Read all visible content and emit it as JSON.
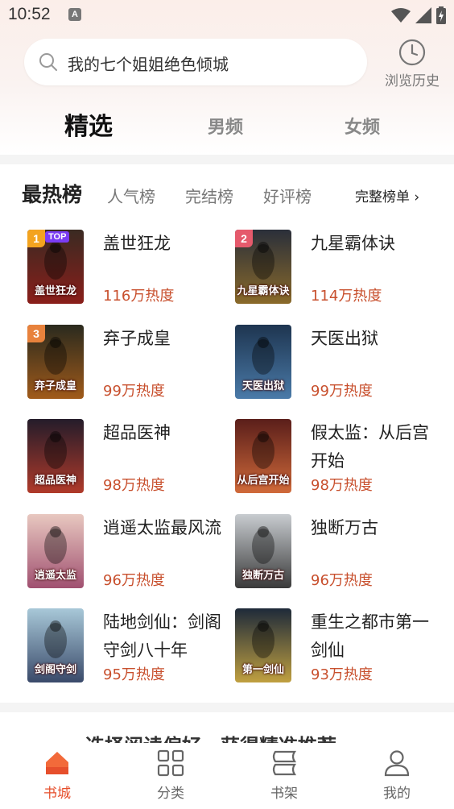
{
  "status": {
    "time": "10:52",
    "notification_letter": "A"
  },
  "search": {
    "placeholder": "我的七个姐姐绝色倾城",
    "history_label": "浏览历史"
  },
  "channel_tabs": [
    {
      "label": "精选",
      "active": true
    },
    {
      "label": "男频",
      "active": false
    },
    {
      "label": "女频",
      "active": false
    }
  ],
  "ranking": {
    "title": "最热榜",
    "tabs": [
      "人气榜",
      "完结榜",
      "好评榜"
    ],
    "more_label": "完整榜单",
    "top_tag": "TOP",
    "books": [
      {
        "rank": "1",
        "title": "盖世狂龙",
        "heat": "116万热度",
        "cover_text": "盖世狂龙"
      },
      {
        "rank": "2",
        "title": "九星霸体诀",
        "heat": "114万热度",
        "cover_text": "九星霸体诀"
      },
      {
        "rank": "3",
        "title": "弃子成皇",
        "heat": "99万热度",
        "cover_text": "弃子成皇"
      },
      {
        "rank": "",
        "title": "天医出狱",
        "heat": "99万热度",
        "cover_text": "天医出狱"
      },
      {
        "rank": "",
        "title": "超品医神",
        "heat": "98万热度",
        "cover_text": "超品医神"
      },
      {
        "rank": "",
        "title": "假太监：从后宫开始",
        "heat": "98万热度",
        "cover_text": "从后宫开始"
      },
      {
        "rank": "",
        "title": "逍遥太监最风流",
        "heat": "96万热度",
        "cover_text": "逍遥太监"
      },
      {
        "rank": "",
        "title": "独断万古",
        "heat": "96万热度",
        "cover_text": "独断万古"
      },
      {
        "rank": "",
        "title": "陆地剑仙：剑阁守剑八十年",
        "heat": "95万热度",
        "cover_text": "剑阁守剑"
      },
      {
        "rank": "",
        "title": "重生之都市第一剑仙",
        "heat": "93万热度",
        "cover_text": "第一剑仙"
      }
    ]
  },
  "promo": {
    "text": "选择阅读偏好，获得精准推荐"
  },
  "nav": [
    {
      "label": "书城",
      "icon": "home-icon",
      "active": true
    },
    {
      "label": "分类",
      "icon": "category-icon",
      "active": false
    },
    {
      "label": "书架",
      "icon": "bookshelf-icon",
      "active": false
    },
    {
      "label": "我的",
      "icon": "profile-icon",
      "active": false
    }
  ],
  "colors": {
    "accent": "#e64f2c",
    "heat": "#c8502e"
  }
}
